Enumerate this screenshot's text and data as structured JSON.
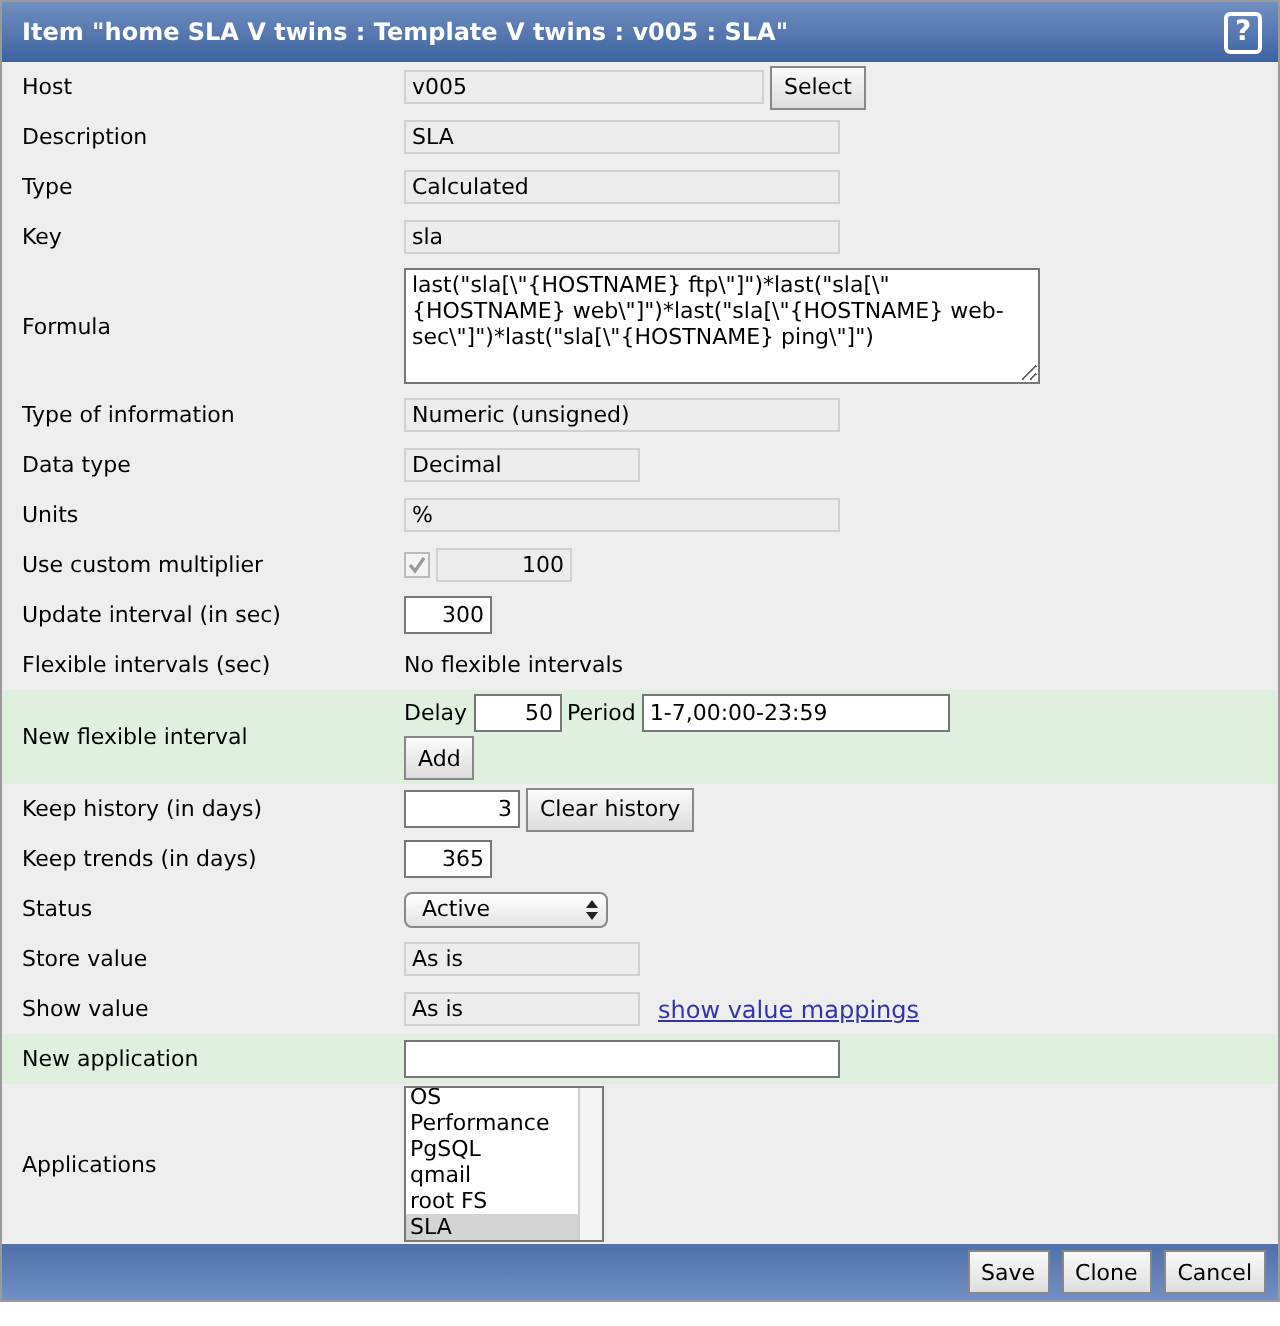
{
  "header": {
    "prefix": "Item \"",
    "links": [
      "home SLA V twins",
      "Template V twins"
    ],
    "separator": " : ",
    "rest": " : v005 : SLA\"",
    "help": "?"
  },
  "rows": [
    {
      "label": "Host",
      "kind": "readonly-button",
      "value": "v005",
      "button": "Select"
    },
    {
      "label": "Description",
      "kind": "readonly-wide",
      "value": "SLA"
    },
    {
      "label": "Type",
      "kind": "readonly-wide",
      "value": "Calculated"
    },
    {
      "label": "Key",
      "kind": "readonly-wide",
      "value": "sla"
    },
    {
      "label": "Formula",
      "kind": "textarea",
      "value": "last(\"sla[\\\"{HOSTNAME} ftp\\\"]\")*last(\"sla[\\\"{HOSTNAME} web\\\"]\")*last(\"sla[\\\"{HOSTNAME} web-sec\\\"]\")*last(\"sla[\\\"{HOSTNAME} ping\\\"]\")"
    },
    {
      "label": "Type of information",
      "kind": "readonly-wide",
      "value": "Numeric (unsigned)"
    },
    {
      "label": "Data type",
      "kind": "readonly-short",
      "value": "Decimal"
    },
    {
      "label": "Units",
      "kind": "readonly-wide",
      "value": "%"
    },
    {
      "label": "Use custom multiplier",
      "kind": "multiplier",
      "checked": true,
      "value": "100"
    },
    {
      "label": "Update interval (in sec)",
      "kind": "number",
      "value": "300"
    },
    {
      "label": "Flexible intervals (sec)",
      "kind": "text",
      "value": "No flexible intervals"
    },
    {
      "label": "New flexible interval",
      "kind": "flex",
      "delay_label": "Delay",
      "delay": "50",
      "period_label": "Period",
      "period": "1-7,00:00-23:59",
      "button": "Add"
    },
    {
      "label": "Keep history (in days)",
      "kind": "number-button",
      "value": "3",
      "button": "Clear history"
    },
    {
      "label": "Keep trends (in days)",
      "kind": "number",
      "value": "365"
    },
    {
      "label": "Status",
      "kind": "select",
      "value": "Active"
    },
    {
      "label": "Store value",
      "kind": "readonly-short",
      "value": "As is"
    },
    {
      "label": "Show value",
      "kind": "readonly-link",
      "value": "As is",
      "link": "show value mappings"
    },
    {
      "label": "New application",
      "kind": "input-green",
      "value": ""
    },
    {
      "label": "Applications",
      "kind": "list",
      "items": [
        {
          "label": "OS",
          "selected": false
        },
        {
          "label": "Performance",
          "selected": false
        },
        {
          "label": "PgSQL",
          "selected": false
        },
        {
          "label": "qmail",
          "selected": false
        },
        {
          "label": "root FS",
          "selected": false
        },
        {
          "label": "SLA",
          "selected": true
        }
      ]
    }
  ],
  "buttons": [
    "Save",
    "Clone",
    "Cancel"
  ]
}
